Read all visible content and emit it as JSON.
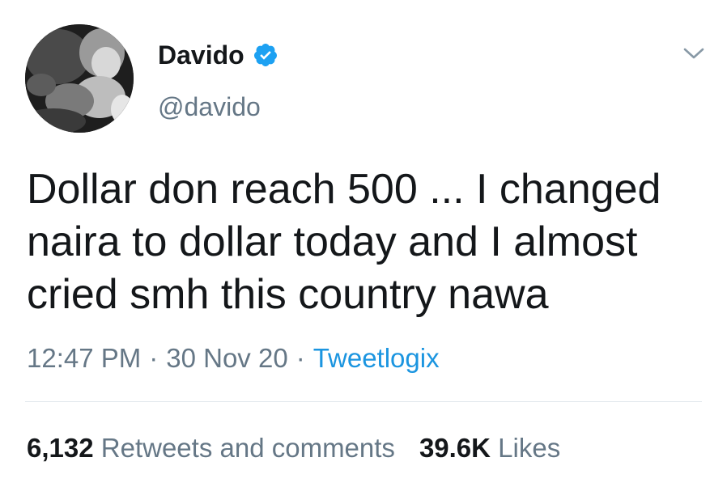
{
  "author": {
    "display_name": "Davido",
    "handle": "@davido",
    "verified_icon": "verified-badge-icon",
    "avatar_icon": "profile-photo"
  },
  "tweet": {
    "text": "Dollar don reach 500 ... I changed naira to dollar today and I almost cried smh this country nawa",
    "time": "12:47 PM",
    "date": "30 Nov 20",
    "source": "Tweetlogix",
    "separator": "·"
  },
  "stats": {
    "retweets_count": "6,132",
    "retweets_label": "Retweets and comments",
    "likes_count": "39.6K",
    "likes_label": "Likes"
  },
  "colors": {
    "text": "#14171a",
    "secondary": "#657786",
    "accent": "#1b95e0",
    "divider": "#e1e8ed"
  },
  "menu": {
    "icon": "chevron-down-icon"
  }
}
